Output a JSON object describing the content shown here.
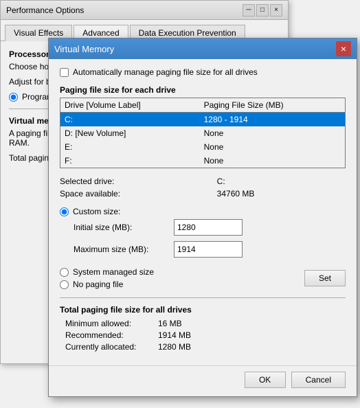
{
  "perf_window": {
    "title": "Performance Options",
    "close_btn": "×",
    "tabs": [
      {
        "label": "Visual Effects",
        "active": false
      },
      {
        "label": "Advanced",
        "active": true
      },
      {
        "label": "Data Execution Prevention",
        "active": false
      }
    ],
    "processor_section_title": "Processor scheduling",
    "processor_text": "Choose how to allocate processor resources.",
    "adjust_text": "Adjust for best performance of:",
    "radio_programs": "Programs",
    "separator": true,
    "virtual_mem_title": "Virtual memory",
    "virtual_mem_text": "A paging file is an area on the hard disk that Windows uses as if it were RAM.",
    "total_paging_label": "Total paging file size for all drives"
  },
  "vm_dialog": {
    "title": "Virtual Memory",
    "close_btn": "×",
    "auto_manage_label": "Automatically manage paging file size for all drives",
    "auto_manage_checked": false,
    "section_title": "Paging file size for each drive",
    "table": {
      "headers": [
        "Drive  [Volume Label]",
        "Paging File Size (MB)"
      ],
      "rows": [
        {
          "drive": "C:",
          "label": "",
          "paging_size": "1280 - 1914",
          "selected": true
        },
        {
          "drive": "D:",
          "label": "[New Volume]",
          "paging_size": "None",
          "selected": false
        },
        {
          "drive": "E:",
          "label": "",
          "paging_size": "None",
          "selected": false
        },
        {
          "drive": "F:",
          "label": "",
          "paging_size": "None",
          "selected": false
        }
      ]
    },
    "selected_drive_label": "Selected drive:",
    "selected_drive_value": "C:",
    "space_available_label": "Space available:",
    "space_available_value": "34760 MB",
    "custom_size_label": "Custom size:",
    "initial_size_label": "Initial size (MB):",
    "initial_size_value": "1280",
    "maximum_size_label": "Maximum size (MB):",
    "maximum_size_value": "1914",
    "system_managed_label": "System managed size",
    "no_paging_label": "No paging file",
    "set_btn_label": "Set",
    "total_section_title": "Total paging file size for all drives",
    "minimum_allowed_label": "Minimum allowed:",
    "minimum_allowed_value": "16 MB",
    "recommended_label": "Recommended:",
    "recommended_value": "1914 MB",
    "currently_allocated_label": "Currently allocated:",
    "currently_allocated_value": "1280 MB",
    "ok_btn": "OK",
    "cancel_btn": "Cancel"
  }
}
